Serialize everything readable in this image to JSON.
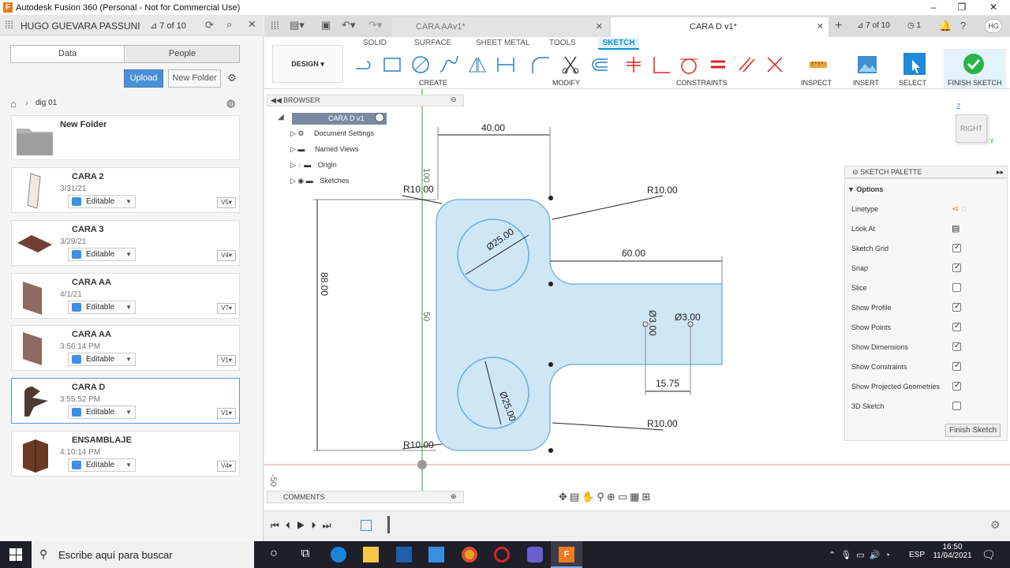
{
  "window": {
    "title": "Autodesk Fusion 360 (Personal - Not for Commercial Use)"
  },
  "data_panel": {
    "user": "HUGO GUEVARA PASSUNI",
    "page": "7 of 10",
    "tabs": [
      "Data",
      "People"
    ],
    "upload_label": "Upload",
    "new_folder_label": "New Folder",
    "breadcrumb": "dig 01",
    "folder_name": "New Folder",
    "files": [
      {
        "name": "CARA 2",
        "date": "3/31/21",
        "status": "Editable",
        "version": "V5"
      },
      {
        "name": "CARA 3",
        "date": "3/29/21",
        "status": "Editable",
        "version": "V4"
      },
      {
        "name": "CARA AA",
        "date": "4/1/21",
        "status": "Editable",
        "version": "V7"
      },
      {
        "name": "CARA AA",
        "date": "3:56:14 PM",
        "status": "Editable",
        "version": "V1"
      },
      {
        "name": "CARA D",
        "date": "3:55:52 PM",
        "status": "Editable",
        "version": "V1"
      },
      {
        "name": "ENSAMBLAJE",
        "date": "4:10:14 PM",
        "status": "Editable",
        "version": "V4"
      }
    ]
  },
  "doc_tabs": {
    "inactive": "CARA AAv1*",
    "active": "CARA D v1*",
    "page": "7 of 10",
    "jobs": "1",
    "avatar": "HG"
  },
  "ribbon": {
    "workspace": "DESIGN",
    "tabs": [
      "SOLID",
      "SURFACE",
      "SHEET METAL",
      "TOOLS",
      "SKETCH"
    ],
    "groups": [
      "CREATE",
      "MODIFY",
      "CONSTRAINTS",
      "INSPECT",
      "INSERT",
      "SELECT",
      "FINISH SKETCH"
    ]
  },
  "browser": {
    "title": "BROWSER",
    "root": "CARA D v1",
    "items": [
      "Document Settings",
      "Named Views",
      "Origin",
      "Sketches"
    ]
  },
  "comments_label": "COMMENTS",
  "viewcube": {
    "face": "RIGHT",
    "axis_z": "Z",
    "axis_y": "Y"
  },
  "sketch": {
    "dims": {
      "top_width": "40.00",
      "height": "88.00",
      "arm_length": "60.00",
      "hole_spacing": "15.75",
      "dia_top": "Ø25.00",
      "dia_bottom": "Ø25.00",
      "small_dia_a": "Ø3.00",
      "small_dia_b": "Ø3.00",
      "r_top_left": "R10.00",
      "r_top_right": "R10.00",
      "r_bottom_left": "R10.00",
      "r_bottom_right": "R10.00"
    },
    "ruler": {
      "v100": "100",
      "v50": "50",
      "vneg50": "-50"
    }
  },
  "palette": {
    "title": "SKETCH PALETTE",
    "section": "Options",
    "rows": [
      {
        "label": "Linetype",
        "kind": "icon"
      },
      {
        "label": "Look At",
        "kind": "icon"
      },
      {
        "label": "Sketch Grid",
        "kind": "check",
        "checked": true
      },
      {
        "label": "Snap",
        "kind": "check",
        "checked": true
      },
      {
        "label": "Slice",
        "kind": "check",
        "checked": false
      },
      {
        "label": "Show Profile",
        "kind": "check",
        "checked": true
      },
      {
        "label": "Show Points",
        "kind": "check",
        "checked": true
      },
      {
        "label": "Show Dimensions",
        "kind": "check",
        "checked": true
      },
      {
        "label": "Show Constraints",
        "kind": "check",
        "checked": true
      },
      {
        "label": "Show Projected Geometries",
        "kind": "check",
        "checked": true
      },
      {
        "label": "3D Sketch",
        "kind": "check",
        "checked": false
      }
    ],
    "finish_label": "Finish Sketch"
  },
  "taskbar": {
    "search_placeholder": "Escribe aquí para buscar",
    "lang": "ESP",
    "time": "16:50",
    "date": "11/04/2021"
  },
  "colors": {
    "accent": "#0696d7",
    "profile": "#cfe6f5",
    "finish_green": "#29b34a"
  }
}
